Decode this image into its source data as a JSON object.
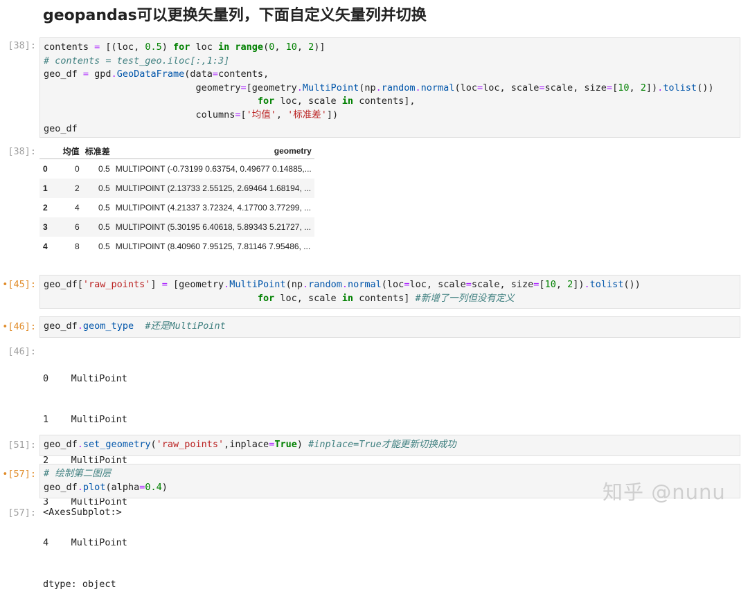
{
  "heading": "geopandas可以更换矢量列，下面自定义矢量列并切换",
  "cells": [
    {
      "prompt": "[38]:",
      "code": [
        [
          [
            "t",
            "contents "
          ],
          [
            "o",
            "="
          ],
          [
            "t",
            " [(loc, "
          ],
          [
            "n",
            "0.5"
          ],
          [
            "t",
            ") "
          ],
          [
            "k",
            "for"
          ],
          [
            "t",
            " loc "
          ],
          [
            "k",
            "in"
          ],
          [
            "t",
            " "
          ],
          [
            "k",
            "range"
          ],
          [
            "t",
            "("
          ],
          [
            "n",
            "0"
          ],
          [
            "t",
            ", "
          ],
          [
            "n",
            "10"
          ],
          [
            "t",
            ", "
          ],
          [
            "n",
            "2"
          ],
          [
            "t",
            ")]"
          ]
        ],
        [
          [
            "c",
            "# contents = test_geo.iloc[:,1:3]"
          ]
        ],
        [
          [
            "t",
            "geo_df "
          ],
          [
            "o",
            "="
          ],
          [
            "t",
            " gpd"
          ],
          [
            "o",
            "."
          ],
          [
            "f",
            "GeoDataFrame"
          ],
          [
            "t",
            "(data"
          ],
          [
            "o",
            "="
          ],
          [
            "t",
            "contents,"
          ]
        ],
        [
          [
            "t",
            "                           geometry"
          ],
          [
            "o",
            "="
          ],
          [
            "t",
            "[geometry"
          ],
          [
            "o",
            "."
          ],
          [
            "f",
            "MultiPoint"
          ],
          [
            "t",
            "(np"
          ],
          [
            "o",
            "."
          ],
          [
            "f",
            "random"
          ],
          [
            "o",
            "."
          ],
          [
            "f",
            "normal"
          ],
          [
            "t",
            "(loc"
          ],
          [
            "o",
            "="
          ],
          [
            "t",
            "loc, scale"
          ],
          [
            "o",
            "="
          ],
          [
            "t",
            "scale, size"
          ],
          [
            "o",
            "="
          ],
          [
            "t",
            "["
          ],
          [
            "n",
            "10"
          ],
          [
            "t",
            ", "
          ],
          [
            "n",
            "2"
          ],
          [
            "t",
            "])"
          ],
          [
            "o",
            "."
          ],
          [
            "f",
            "tolist"
          ],
          [
            "t",
            "())"
          ]
        ],
        [
          [
            "t",
            "                                      "
          ],
          [
            "k",
            "for"
          ],
          [
            "t",
            " loc, scale "
          ],
          [
            "k",
            "in"
          ],
          [
            "t",
            " contents],"
          ]
        ],
        [
          [
            "t",
            "                           columns"
          ],
          [
            "o",
            "="
          ],
          [
            "t",
            "["
          ],
          [
            "s",
            "'均值'"
          ],
          [
            "t",
            ", "
          ],
          [
            "s",
            "'标准差'"
          ],
          [
            "t",
            "])"
          ]
        ],
        [
          [
            "t",
            "geo_df"
          ]
        ]
      ]
    },
    {
      "prompt": "•[45]:",
      "code": [
        [
          [
            "t",
            "geo_df["
          ],
          [
            "s",
            "'raw_points'"
          ],
          [
            "t",
            "] "
          ],
          [
            "o",
            "="
          ],
          [
            "t",
            " [geometry"
          ],
          [
            "o",
            "."
          ],
          [
            "f",
            "MultiPoint"
          ],
          [
            "t",
            "(np"
          ],
          [
            "o",
            "."
          ],
          [
            "f",
            "random"
          ],
          [
            "o",
            "."
          ],
          [
            "f",
            "normal"
          ],
          [
            "t",
            "(loc"
          ],
          [
            "o",
            "="
          ],
          [
            "t",
            "loc, scale"
          ],
          [
            "o",
            "="
          ],
          [
            "t",
            "scale, size"
          ],
          [
            "o",
            "="
          ],
          [
            "t",
            "["
          ],
          [
            "n",
            "10"
          ],
          [
            "t",
            ", "
          ],
          [
            "n",
            "2"
          ],
          [
            "t",
            "])"
          ],
          [
            "o",
            "."
          ],
          [
            "f",
            "tolist"
          ],
          [
            "t",
            "())"
          ]
        ],
        [
          [
            "t",
            "                                      "
          ],
          [
            "k",
            "for"
          ],
          [
            "t",
            " loc, scale "
          ],
          [
            "k",
            "in"
          ],
          [
            "t",
            " contents] "
          ],
          [
            "c",
            "#新增了一列但没有定义"
          ]
        ]
      ]
    },
    {
      "prompt": "•[46]:",
      "code": [
        [
          [
            "t",
            "geo_df"
          ],
          [
            "o",
            "."
          ],
          [
            "f",
            "geom_type"
          ],
          [
            "t",
            "  "
          ],
          [
            "c",
            "#还是MultiPoint"
          ]
        ]
      ]
    },
    {
      "prompt": "[51]:",
      "code": [
        [
          [
            "t",
            "geo_df"
          ],
          [
            "o",
            "."
          ],
          [
            "f",
            "set_geometry"
          ],
          [
            "t",
            "("
          ],
          [
            "s",
            "'raw_points'"
          ],
          [
            "t",
            ",inplace"
          ],
          [
            "o",
            "="
          ],
          [
            "k",
            "True"
          ],
          [
            "t",
            ") "
          ],
          [
            "c",
            "#inplace=True才能更新切换成功"
          ]
        ]
      ]
    },
    {
      "prompt": "•[57]:",
      "code": [
        [
          [
            "c",
            "# 绘制第二图层"
          ]
        ],
        [
          [
            "t",
            "geo_df"
          ],
          [
            "o",
            "."
          ],
          [
            "f",
            "plot"
          ],
          [
            "t",
            "(alpha"
          ],
          [
            "o",
            "="
          ],
          [
            "n",
            "0.4"
          ],
          [
            "t",
            ")"
          ]
        ]
      ]
    }
  ],
  "out38": {
    "prompt": "[38]:",
    "columns": [
      "",
      "均值",
      "标准差",
      "geometry"
    ],
    "rows": [
      [
        "0",
        "0",
        "0.5",
        "MULTIPOINT (-0.73199 0.63754, 0.49677 0.14885,..."
      ],
      [
        "1",
        "2",
        "0.5",
        "MULTIPOINT (2.13733 2.55125, 2.69464 1.68194, ..."
      ],
      [
        "2",
        "4",
        "0.5",
        "MULTIPOINT (4.21337 3.72324, 4.17700 3.77299, ..."
      ],
      [
        "3",
        "6",
        "0.5",
        "MULTIPOINT (5.30195 6.40618, 5.89343 5.21727, ..."
      ],
      [
        "4",
        "8",
        "0.5",
        "MULTIPOINT (8.40960 7.95125, 7.81146 7.95486, ..."
      ]
    ]
  },
  "out46": {
    "prompt": "[46]:",
    "lines": [
      "0    MultiPoint",
      "1    MultiPoint",
      "2    MultiPoint",
      "3    MultiPoint",
      "4    MultiPoint",
      "dtype: object"
    ]
  },
  "out57": {
    "prompt": "[57]:",
    "text": "<AxesSubplot:>"
  },
  "watermark": "知乎 @nunu"
}
